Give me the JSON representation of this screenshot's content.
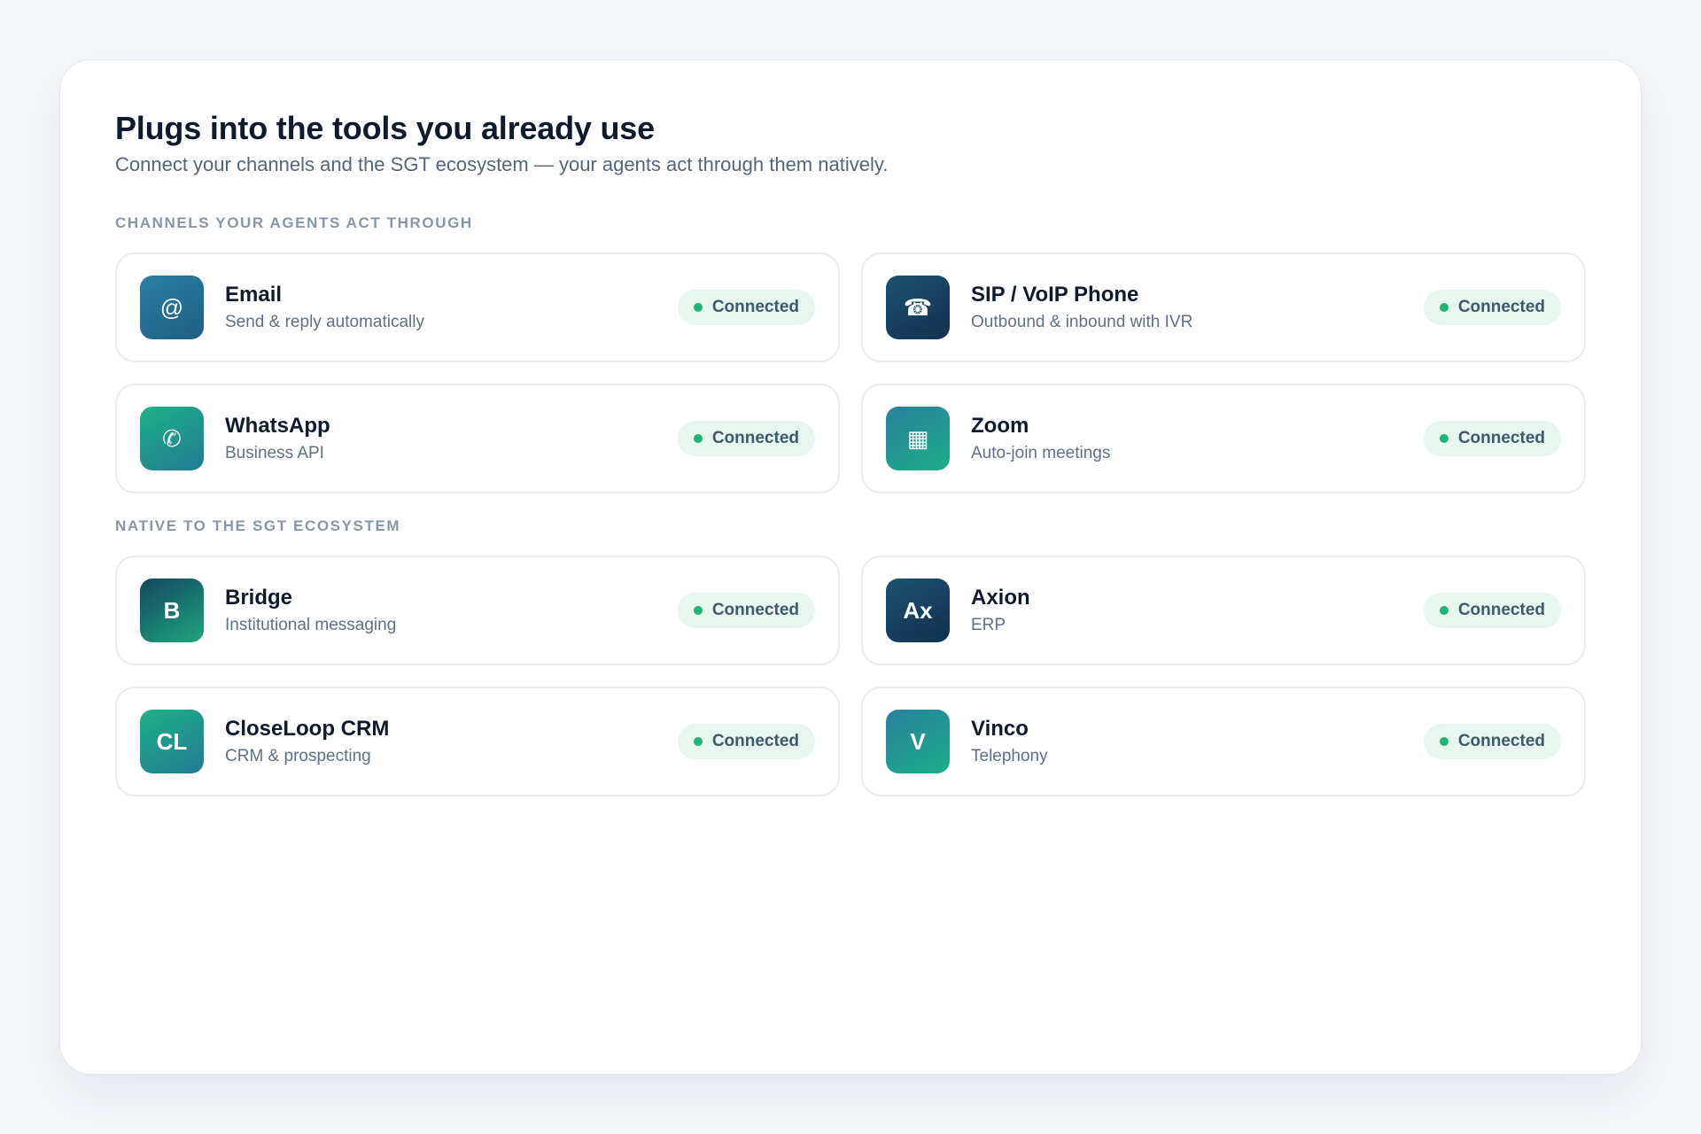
{
  "header": {
    "title": "Plugs into the tools you already use",
    "subtitle": "Connect your channels and the SGT ecosystem — your agents act through them natively."
  },
  "sections": [
    {
      "label": "CHANNELS YOUR AGENTS ACT THROUGH",
      "items": [
        {
          "name": "Email",
          "desc": "Send & reply automatically",
          "icon": "@",
          "icon_name": "email-icon",
          "status": "Connected"
        },
        {
          "name": "SIP / VoIP Phone",
          "desc": "Outbound & inbound with IVR",
          "icon": "☎",
          "icon_name": "phone-icon",
          "status": "Connected"
        },
        {
          "name": "WhatsApp",
          "desc": "Business API",
          "icon": "✆",
          "icon_name": "whatsapp-icon",
          "status": "Connected"
        },
        {
          "name": "Zoom",
          "desc": "Auto-join meetings",
          "icon": "▦",
          "icon_name": "calendar-icon",
          "status": "Connected"
        }
      ]
    },
    {
      "label": "NATIVE TO THE SGT ECOSYSTEM",
      "items": [
        {
          "name": "Bridge",
          "desc": "Institutional messaging",
          "icon": "B",
          "icon_name": "bridge-logo",
          "status": "Connected"
        },
        {
          "name": "Axion",
          "desc": "ERP",
          "icon": "Ax",
          "icon_name": "axion-logo",
          "status": "Connected"
        },
        {
          "name": "CloseLoop CRM",
          "desc": "CRM & prospecting",
          "icon": "CL",
          "icon_name": "closeloop-logo",
          "status": "Connected"
        },
        {
          "name": "Vinco",
          "desc": "Telephony",
          "icon": "V",
          "icon_name": "vinco-logo",
          "status": "Connected"
        }
      ]
    }
  ],
  "colors": {
    "status_dot": "#1fb574",
    "badge_bg": "#e7f6ee",
    "title": "#0f1b2d",
    "section_label": "#8797a9"
  }
}
